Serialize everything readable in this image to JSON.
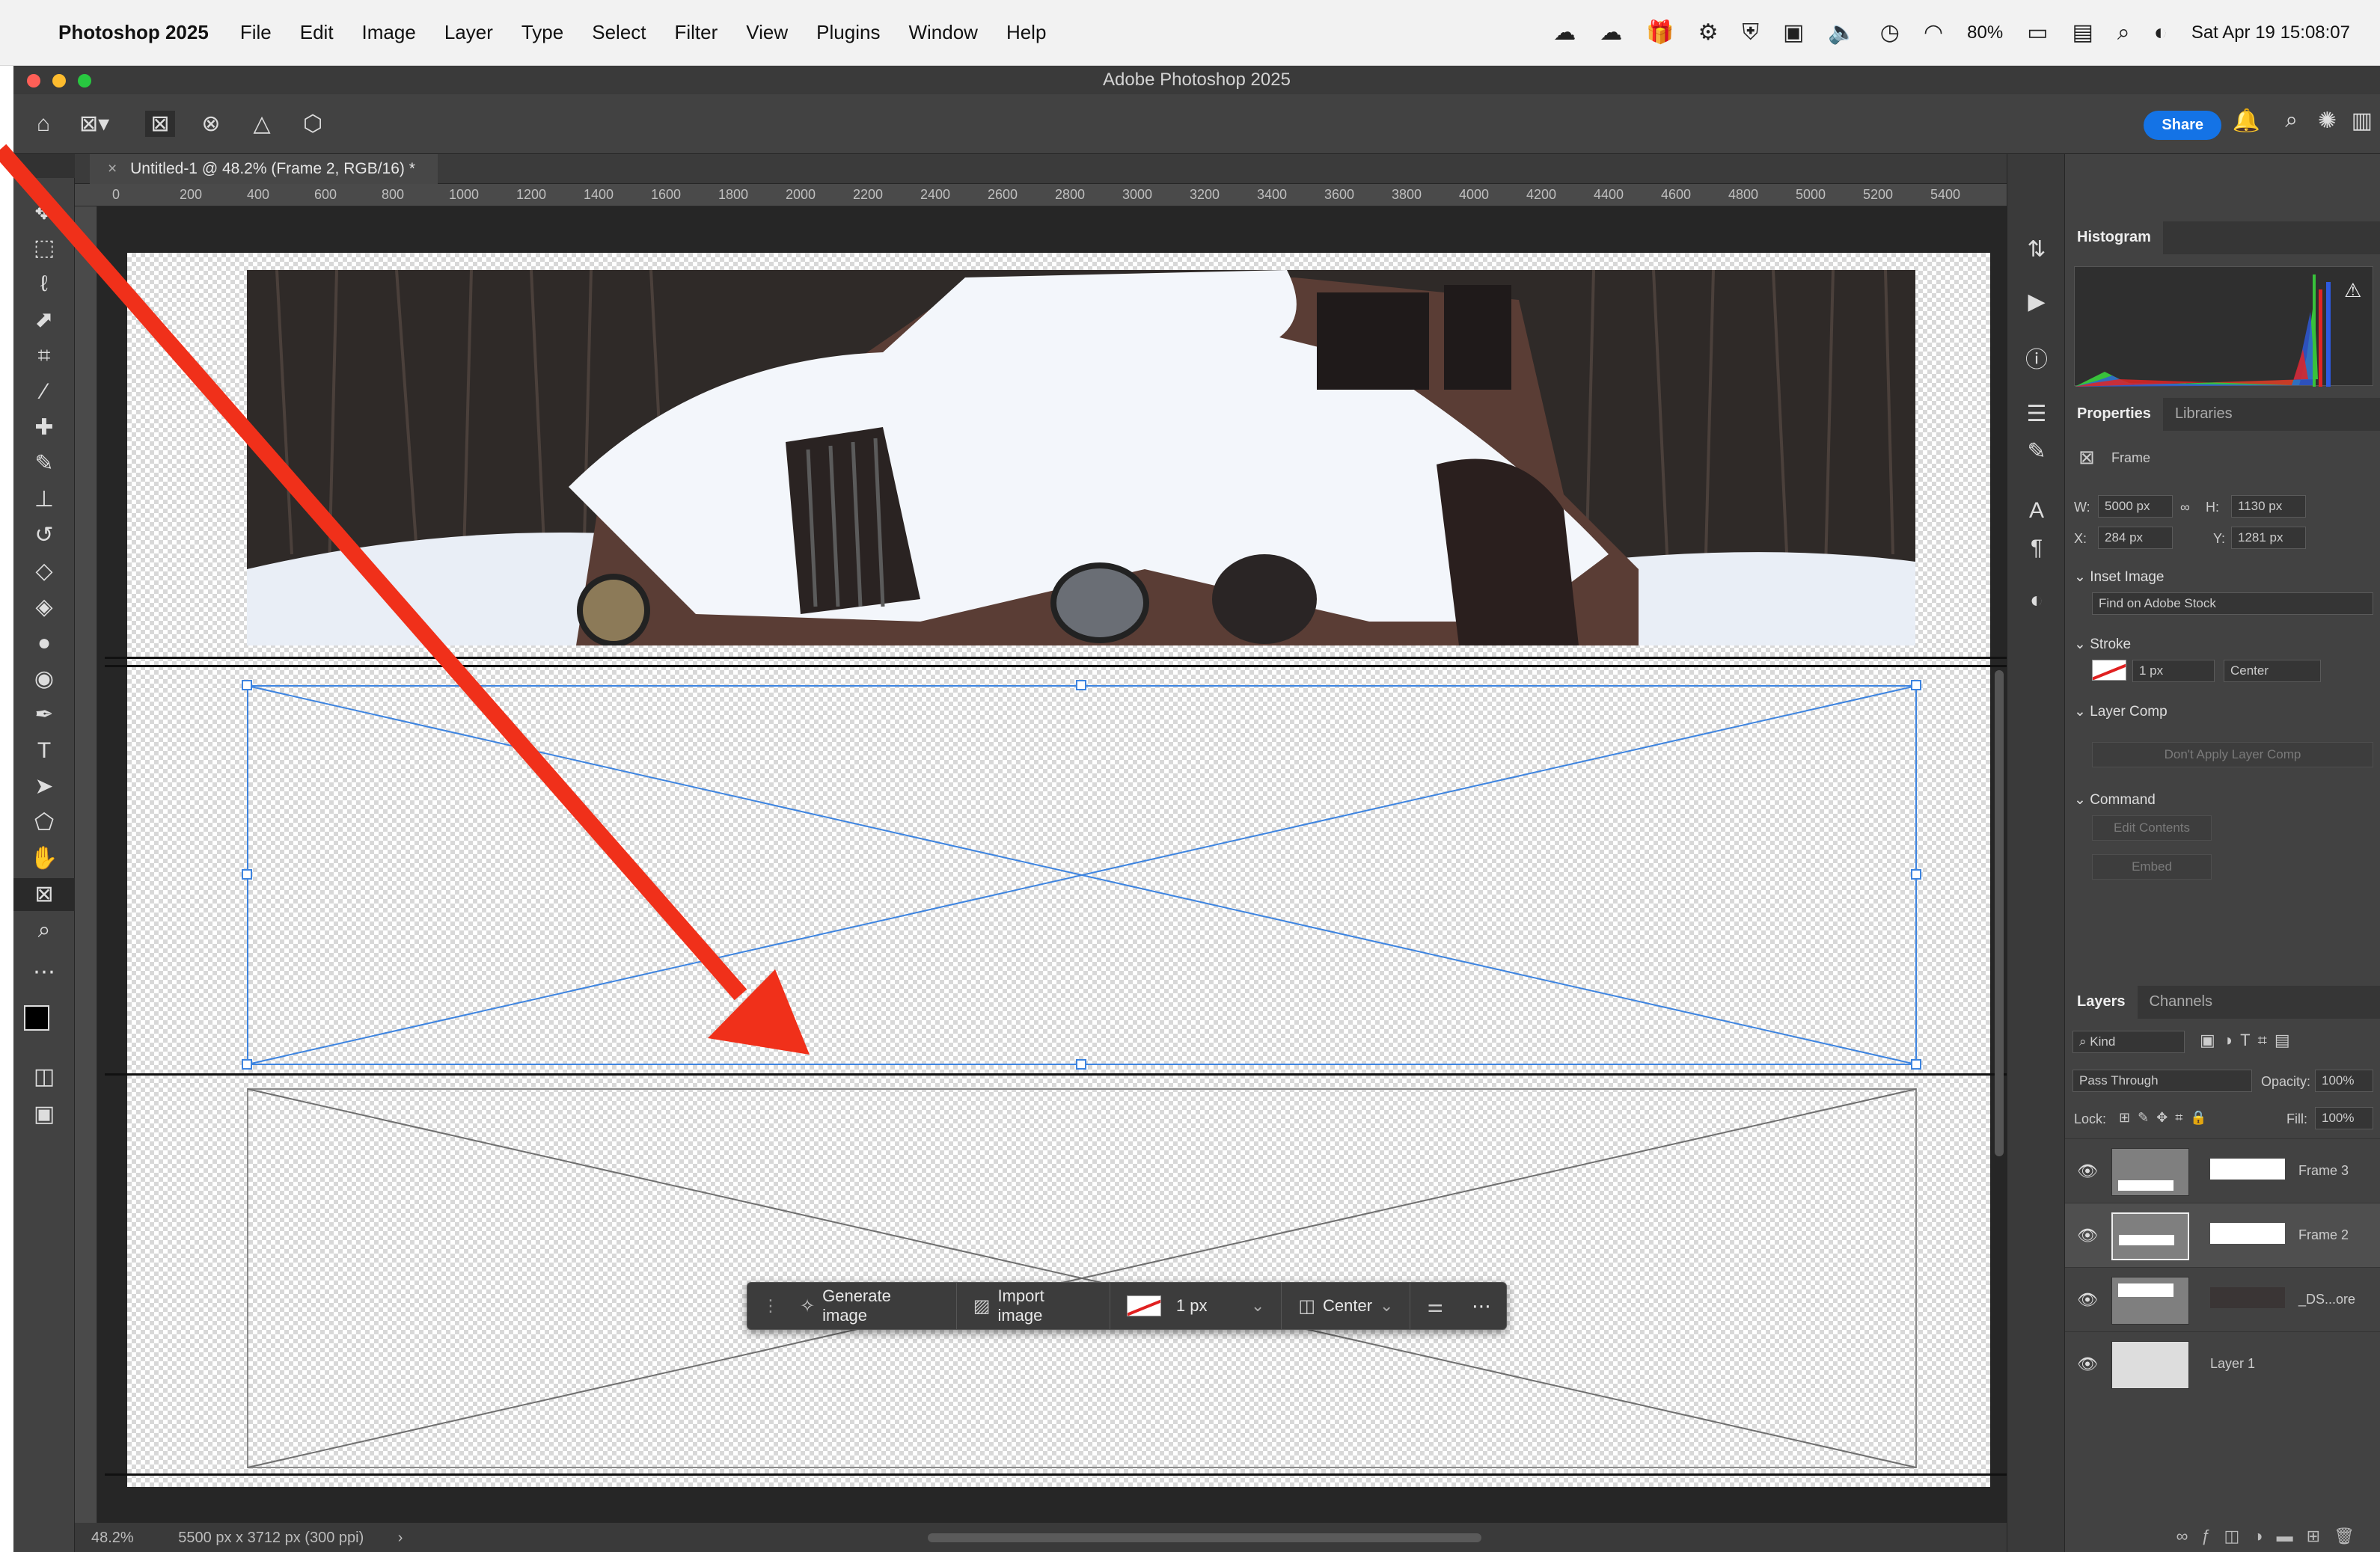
{
  "menubar": {
    "app_name": "Photoshop 2025",
    "items": [
      "File",
      "Edit",
      "Image",
      "Layer",
      "Type",
      "Select",
      "Filter",
      "View",
      "Plugins",
      "Window",
      "Help"
    ],
    "battery": "80%",
    "datetime": "Sat Apr 19 15:08:07"
  },
  "window": {
    "title": "Adobe Photoshop 2025",
    "share_label": "Share"
  },
  "document": {
    "tab_title": "Untitled-1 @ 48.2% (Frame 2, RGB/16) *",
    "zoom": "48.2%",
    "dimensions": "5500 px x 3712 px (300 ppi)"
  },
  "ruler": {
    "h_ticks": [
      "0",
      "200",
      "400",
      "600",
      "800",
      "1000",
      "1200",
      "1400",
      "1600",
      "1800",
      "2000",
      "2200",
      "2400",
      "2600",
      "2800",
      "3000",
      "3200",
      "3400",
      "3600",
      "3800",
      "4000",
      "4200",
      "4400",
      "4600",
      "4800",
      "5000",
      "5200",
      "5400"
    ]
  },
  "context_bar": {
    "generate_label": "Generate image",
    "import_label": "Import image",
    "stroke_width": "1 px",
    "align": "Center"
  },
  "panels": {
    "histogram_tab": "Histogram",
    "properties_tab": "Properties",
    "libraries_tab": "Libraries",
    "kind": "Frame",
    "w_label": "W:",
    "w_value": "5000 px",
    "h_label": "H:",
    "h_value": "1130 px",
    "x_label": "X:",
    "x_value": "284 px",
    "y_label": "Y:",
    "y_value": "1281 px",
    "inset_image": "Inset Image",
    "find_stock": "Find on Adobe Stock",
    "stroke": "Stroke",
    "stroke_width": "1 px",
    "stroke_align": "Center",
    "layer_comp": "Layer Comp",
    "layer_comp_value": "Don't Apply Layer Comp",
    "command": "Command",
    "edit_contents": "Edit Contents",
    "embed": "Embed",
    "layers_tab": "Layers",
    "channels_tab": "Channels",
    "filter_kind": "Kind",
    "blend_mode": "Pass Through",
    "opacity_label": "Opacity:",
    "opacity": "100%",
    "lock_label": "Lock:",
    "fill_label": "Fill:",
    "fill": "100%",
    "layers": [
      {
        "name": "Frame 3"
      },
      {
        "name": "Frame 2"
      },
      {
        "name": "_DS...ore"
      },
      {
        "name": "Layer 1"
      }
    ]
  },
  "colors": {
    "accent": "#1473e6",
    "selection": "#3d84e0",
    "arrow": "#f0301a"
  }
}
